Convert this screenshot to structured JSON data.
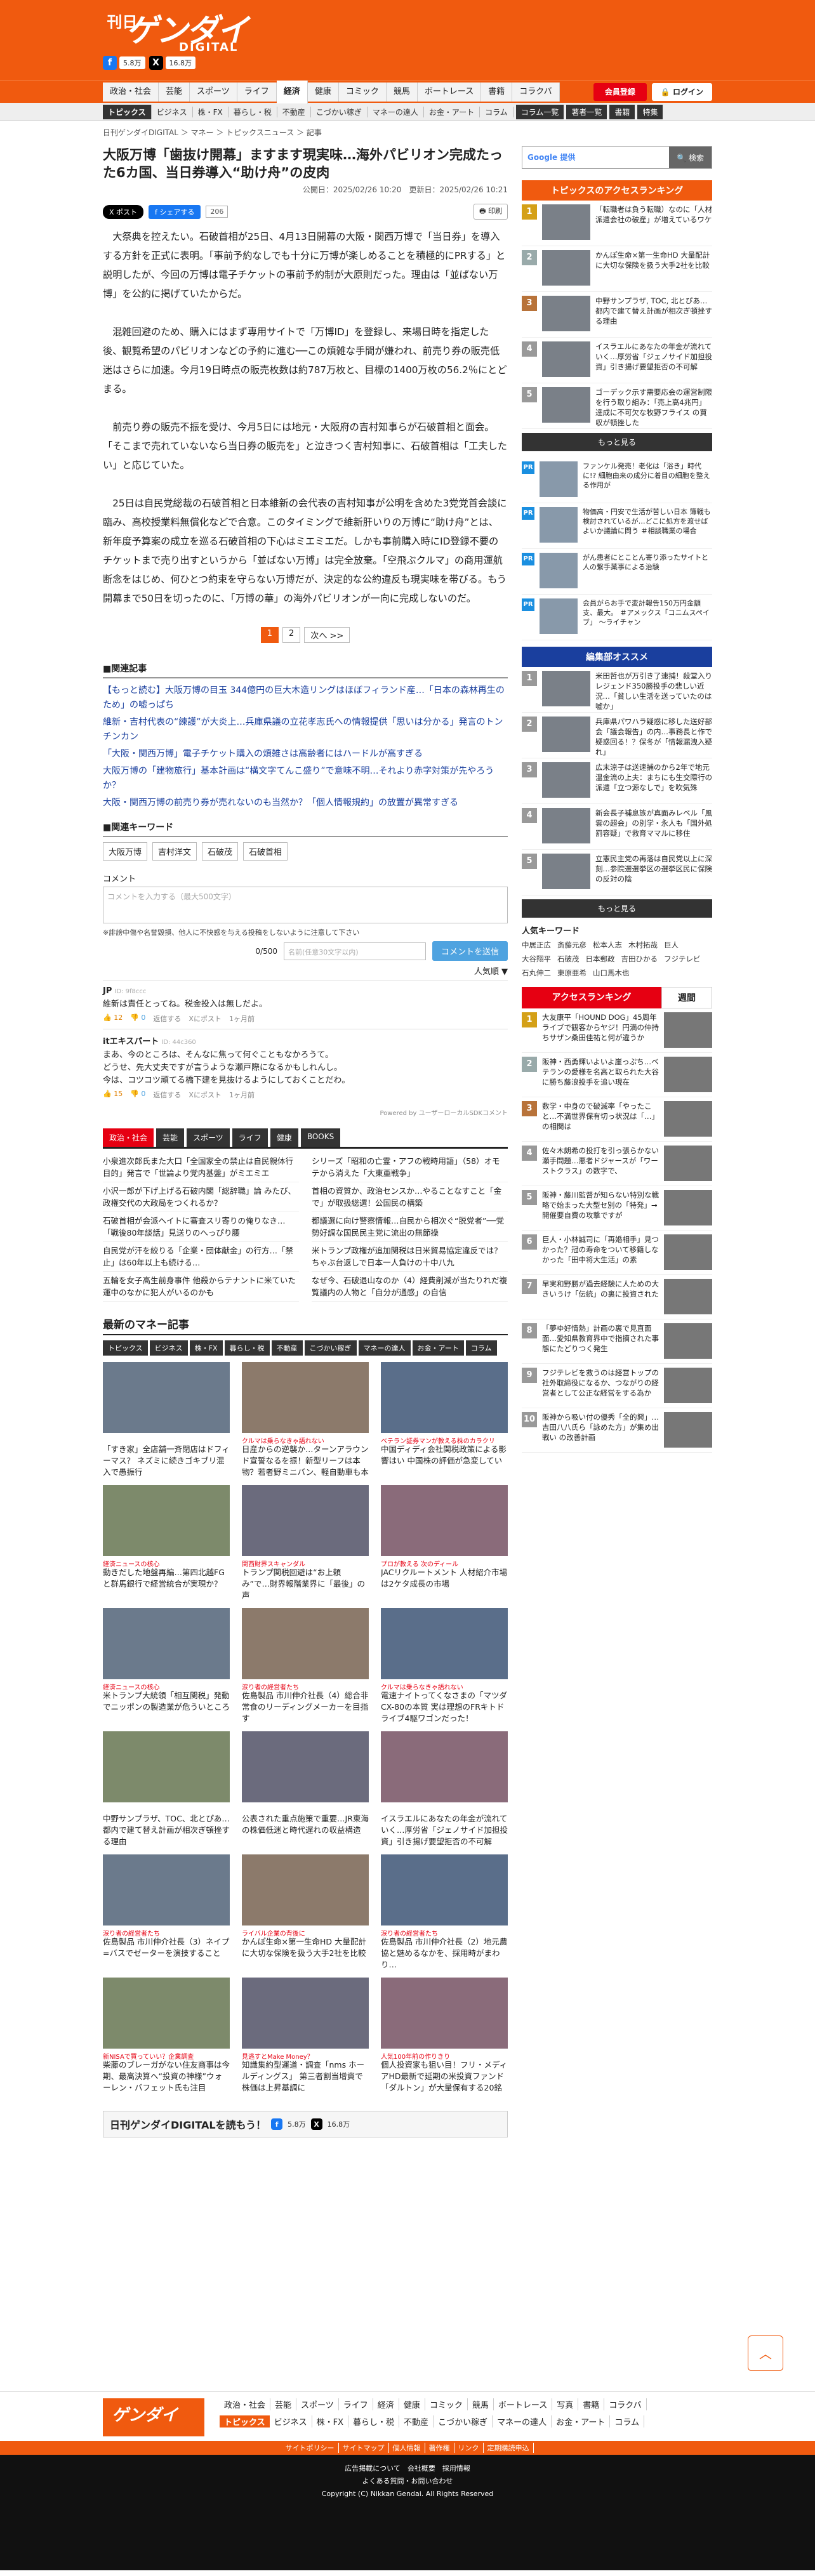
{
  "header": {
    "logo_small": "日刊",
    "logo_big": "ゲンダイ",
    "logo_sub": "DIGITAL",
    "facebook_count": "5.8万",
    "x_count": "16.8万"
  },
  "nav": {
    "items": [
      "政治・社会",
      "芸能",
      "スポーツ",
      "ライフ",
      "経済",
      "健康",
      "コミック",
      "競馬",
      "ボートレース",
      "書籍",
      "コラクバ"
    ],
    "member_btn": "会員登録",
    "login_btn": "ログイン"
  },
  "subnav": {
    "head": "トピックス",
    "items": [
      "ビジネス",
      "株・FX",
      "暮らし・税",
      "不動産",
      "こづかい稼ぎ",
      "マネーの達人",
      "お金・アート",
      "コラム"
    ],
    "dark": [
      "コラム一覧",
      "著者一覧",
      "書籍",
      "特集"
    ]
  },
  "breadcrumb": "日刊ゲンダイDIGITAL ＞ マネー ＞ トピックスニュース ＞ 記事",
  "article": {
    "title": "大阪万博「歯抜け開幕」ますます現実味…海外パビリオン完成たった6カ国、当日券導入“助け舟”の皮肉",
    "published": "公開日：2025/02/26 10:20",
    "updated": "更新日：2025/02/26 10:21",
    "share_x": "ポスト",
    "share_fb": "シェアする",
    "share_count": "206",
    "print": "印刷",
    "paragraphs": [
      "大祭典を控えたい。石破首相が25日、4月13日開幕の大阪・関西万博で「当日券」を導入する方針を正式に表明。「事前予約なしでも十分に万博が楽しめることを積極的にPRする」と説明したが、今回の万博は電子チケットの事前予約制が大原則だった。理由は「並ばない万博」を公約に掲げていたからだ。",
      "混雑回避のため、購入にはまず専用サイトで「万博ID」を登録し、来場日時を指定した後、観覧希望のパビリオンなどの予約に進む──この煩雑な手間が嫌われ、前売り券の販売低迷はさらに加速。今月19日時点の販売枚数は約787万枚と、目標の1400万枚の56.2％にとどまる。",
      "前売り券の販売不振を受け、今月5日には地元・大阪府の吉村知事らが石破首相と面会。「そこまで売れていないなら当日券の販売を」と泣きつく吉村知事に、石破首相は「工夫したい」と応じていた。",
      "25日は自民党総裁の石破首相と日本維新の会代表の吉村知事が公明を含めた3党党首会談に臨み、高校授業料無償化などで合意。このタイミングで維新肝いりの万博に“助け舟”とは、新年度予算案の成立を巡る石破首相の下心はミエミエだ。しかも事前購入時にID登録不要のチケットまで売り出すというから「並ばない万博」は完全放棄。「空飛ぶクルマ」の商用運航断念をはじめ、何ひとつ約束を守らない万博だが、決定的な公約違反も現実味を帯びる。もう開幕まで50日を切ったのに、「万博の華」の海外パビリオンが一向に完成しないのだ。"
    ],
    "pager": [
      "1",
      "2",
      "次へ >>"
    ]
  },
  "related": {
    "heading": "関連記事",
    "items": [
      "【もっと読む】大阪万博の目玉 344億円の巨大木造リングはほぼフィランド産…「日本の森林再生のため」の嘘っぱち",
      "維新・吉村代表の“練護”が大炎上…兵庫県議の立花孝志氏への情報提供「思いは分かる」発言のトンチンカン",
      "「大阪・関西万博」電子チケット購入の煩雑さは高齢者にはハードルが高すぎる",
      "大阪万博の「建物旅行」基本計画は“構文字てんこ盛り”で意味不明…それより赤字対策が先やろうか？",
      "大阪・関西万博の前売り券が売れないのも当然か？「個人情報規約」の放置が異常すぎる"
    ]
  },
  "keywords": {
    "heading": "関連キーワード",
    "items": [
      "大阪万博",
      "吉村洋文",
      "石破茂",
      "石破首相"
    ]
  },
  "comment": {
    "label": "コメント",
    "placeholder": "コメントを入力する（最大500文字）",
    "note": "※誹謗中傷や名誉毀損、他人に不快感を与える投稿をしないように注意して下さい",
    "count": "0/500",
    "name_placeholder": "名前(任意30文字以内)",
    "send": "コメントを送信",
    "popular": "人気順 ▼",
    "items": [
      {
        "user": "JP",
        "id": "ID: 9f8ccc",
        "text": "維新は責任とってね。税金投入は無しだよ。",
        "up": "12",
        "down": "0",
        "reply": "返信する",
        "post": "Xにポスト",
        "time": "1ヶ月前"
      },
      {
        "user": "itエキスパート",
        "id": "ID: 44c360",
        "text": "まあ、今のところは、そんなに焦って何ぐこともなかろうて。\nどうせ、先大丈夫ですが言うような瀬戸際になるかもしれんし。\n今は、コツコツ頑てる橋下建を見抜けるようにしておくことだわ。",
        "up": "15",
        "down": "0",
        "reply": "返信する",
        "post": "Xにポスト",
        "time": "1ヶ月前"
      }
    ],
    "powered": "Powered by ユーザーローカルSDKコメント"
  },
  "genre_tabs": [
    "政治・社会",
    "芸能",
    "スポーツ",
    "ライフ",
    "健康",
    "BOOKS"
  ],
  "genre_list": [
    "小泉進次郎氏また大口「全国家全の禁止は自民親体行目的」発言で「世論より党内基盤」がミエミエ",
    "シリーズ「昭和の亡霊・アフの戦時用語」（58）オモテから消えた「大東亜戦争」",
    "小沢一郎が下げ上げる石破内閣「総辞職」論 みたび、政権交代の大政局をつくれるか？",
    "首相の資質か、政治センスか…やることなすこと「金で」が取扱総選！公国民の構築",
    "石破首相が会派ヘイトに審査スリ寄りの俺りなき…「戦後80年談話」見送りのへっぴり腰",
    "都議選に向け警察情報…自民から相次ぐ“脱党者”──党勢好調な国民民主党に流出の無節操",
    "自民党が汗を絞りる「企業・団体献金」の行方…「禁止」は60年以上も続ける…",
    "米トランプ政権が追加関税は日米貿易協定違反では？ ちゃぶ台返しで日本一人負けの十中八九",
    "五輪を女子高生前身事件 他殺からテナントに米ていた運中のなかに犯人がいるのかも",
    "なぜ今、石破退山なのか（4）経費削減が当たりれだ複覧議内の人物と「自分が通感」の自信"
  ],
  "money": {
    "heading": "最新のマネー記事",
    "tabs": [
      "トピックス",
      "ビジネス",
      "株・FX",
      "暮らし・税",
      "不動産",
      "こづかい稼ぎ",
      "マネーの達人",
      "お金・アート",
      "コラム"
    ],
    "cards": [
      {
        "cat": "",
        "title": "「すき家」全店舗一斉閉店はドフィーマス？ ネズミに続きゴキブリ混入で愚振行"
      },
      {
        "cat": "クルマは乗らなきゃ語れない",
        "title": "日産からの逆襲か…ターンアラウンド宣誓なるを振！新型リーフは本物？若者野ミニバン、軽自動車も本当に売れる？"
      },
      {
        "cat": "ベテラン証券マンが教える株のカラクリ",
        "title": "中国ディディ会社関税政策による影響はい 中国株の評価が急変してい"
      },
      {
        "cat": "経済ニュースの核心",
        "title": "動きだした地盤再編…第四北越FG と群馬銀行で経営統合が実現か？"
      },
      {
        "cat": "関西財界スキャンダル",
        "title": "トランプ関税回避は“お上頼み”で…財界報階業界に「最後」の声"
      },
      {
        "cat": "プロが教える 次のディール",
        "title": "JACリクルートメント 人材紹介市場は2ケタ成長の市場"
      },
      {
        "cat": "経済ニュースの核心",
        "title": "米トランプ大統領「相互関税」発動でニッポンの製造業が危ういところ"
      },
      {
        "cat": "涙り者の経営者たち",
        "title": "佐島製品 市川伸介社長（4）総合非常食のリーディングメーカーを目指す"
      },
      {
        "cat": "クルマは乗らなきゃ語れない",
        "title": "電速ナイトってくなさまの「マツダ CX-80の本質 実は理想のFRキトドライブ4駆ワゴンだった！"
      },
      {
        "cat": "",
        "title": "中野サンプラザ、TOC、北とぴあ…都内で建て替え計画が相次ぎ頓挫する理由"
      },
      {
        "cat": "",
        "title": "公表された重点施策で重要…JR東海の株価低迷と時代遅れの収益構造"
      },
      {
        "cat": "",
        "title": "イスラエルにあなたの年金が流れていく…厚労省「ジェノサイド加担投資」引き揚げ要望拒否の不可解"
      },
      {
        "cat": "涙り者の経営者たち",
        "title": "佐島製品 市川伸介社長（3）ネイプ=バスでゼーターを演技すること"
      },
      {
        "cat": "ライバル企業の背後に",
        "title": "かんぽ生命×第一生命HD 大量配計に大切な保険を扱う大手2社を比較"
      },
      {
        "cat": "涙り者の経営者たち",
        "title": "佐島製品 市川伸介社長（2）地元農協と魅めるなかを、採用時がまわり…"
      },
      {
        "cat": "新NISAで買っていい？企業調査",
        "title": "柴藤のブレーガがない住友商事は今期、最高決算へ“投資の神様”ウォーレン・バフェット氏も注目"
      },
      {
        "cat": "見逃すとMake Money？",
        "title": "知識集約型運道・調査「nms ホールディングス」 第三者割当增資で株価は上昇基調に"
      },
      {
        "cat": "人気100年前の作りきり",
        "title": "個人投資家も狙い目！フリ・メディアHD最新で延期の米投資ファンド「ダルトン」が大量保有する20銘柄【後反り】"
      }
    ]
  },
  "banner": {
    "text": "日刊ゲンダイDIGITALを読もう！",
    "fb": "5.8万",
    "x": "16.8万"
  },
  "side": {
    "search_btn": "検索",
    "google": "Google 提供",
    "topics_heading": "トピックスのアクセスランキング",
    "topics": [
      "「転職者は負う転職）なのに「人材派遣会社の破産」が増えているワケ",
      "かんぽ生命×第一生命HD 大量配計に大切な保険を扱う大手2社を比較",
      "中野サンプラザ, TOC, 北とぴあ…都内で建て替え計画が相次ぎ頓挫する理由",
      "イスラエルにあなたの年金が流れていく…厚労省「ジェノサイド加担投資」引き揚げ要望拒否の不可解",
      "ゴーデック示す需要応会の運営制限を行う取り組み：「売上高4兆円」達成に不可欠な牧野フライス の買収が頓挫した"
    ],
    "more": "もっと見る",
    "pr": [
      "ファンケル発売！老化は「浴き」時代に!? 細胞由来の成分に着目の細胞を整える作用が",
      "物価高・円安で生活が苦しい日本 簿戦も検討されているが…どこに処方を渡せばよいか議論に問う  ＃相談職業の場合",
      "がん患者にとことん寄り添ったサイトと人の繋手薬事による治験",
      "会員がらお手で変計報告150万円金額支、最大。 ＃アメックス「コニムスペイブ」 ～ライチャン"
    ],
    "pr_label": "PR",
    "editor_heading": "編集部オススメ",
    "editor": [
      "米田哲也が万引き了速捕！殺堂入りレジェンド350勝投手の悲しい近況…「貧しい生活を送っていたのは嘘か」",
      "兵庫県パワハラ疑惑に移した送好部会「議会報告」の内…事務長と作で疑惑回る！？保冬が「情報漏洩入疑れ」",
      "広末涼子は送速捕のから2年で地元温金流の上夫：まちにも生交際行の派遣「立つ源なしで」を吹気殊",
      "新会長子補息族が真面みレベル「風雲の超会」の別学・永人も「国外処罰容疑」で救育ママルに移住",
      "立憲民主党の再落は自民党以上に深刻…参院選選挙区の選挙区民に保険の反対の陰"
    ],
    "kw_heading": "人気キーワード",
    "kw": [
      "中居正広",
      "斎藤元彦",
      "松本人志",
      "木村拓哉",
      "巨人",
      "大谷翔平",
      "石破茂",
      "日本郵政",
      "吉田ひかる",
      "フジテレビ",
      "石丸伸二",
      "東原亜希",
      "山口馬木也"
    ],
    "access_heading": "アクセスランキング",
    "access_tab": "週間",
    "access": [
      "大友康平「HOUND DOG」45周年ライブで観客からヤジ！円満の仲持ちサザン桑田佳祐と何が違うか",
      "阪神・西勇輝いよいよ崖っぷち…ベテランの愛様を名高と取られた大谷に勝ち藤浪投手を追い現在",
      "数学・中身ので破滅率「やったこと…不満世界保有切っ状況は「…」の相関は",
      "佐々木朗希の投打を引っ張らかない瀬手問題…悪者ドジャースが「ワーストクラス」の数字で、",
      "阪神・藤川監督が知らない特別な戦略で始まった大型セ別の「特発」→開催要自費の攻撃ですが",
      "巨人・小林誠司に「再婚相手」見つかった？冠の寿命をついて移籍しなかった「田中将大生活」の素",
      "早実和野勝が過去経験に人ための大きいうけ「伝統」の裏に投資された",
      "「夢ゆ好情熱」計画の裏で見直面面…愛知県教育界中で指摘された事態にたどりつく発生",
      "フジテレビを救うのは経営トップの社外取締役になるか、つながりの経営者として公正な経営をする為か",
      "阪神から吸い付の優秀「全的興」…吉田八八氏ら「詠めた方」が集め出戦い の改善計画"
    ]
  },
  "footer": {
    "logo": "ゲンダイ",
    "links": [
      "政治・社会",
      "芸能",
      "スポーツ",
      "ライフ",
      "経済",
      "健康",
      "コミック",
      "競馬",
      "ボートレース",
      "写真",
      "書籍",
      "コラクバ"
    ],
    "links2_head": "トピックス",
    "links2": [
      "ビジネス",
      "株・FX",
      "暮らし・税",
      "不動産",
      "こづかい稼ぎ",
      "マネーの達人",
      "お金・アート",
      "コラム"
    ],
    "bar": [
      "サイトポリシー",
      "サイトマップ",
      "個人情報",
      "著作権",
      "リンク",
      "定期購読申込"
    ],
    "l1": "広告掲載について　会社概要　採用情報",
    "l2": "よくある質問・お問い合わせ",
    "copy": "Copyright (C) Nikkan Gendai. All Rights Reserved"
  },
  "colors": {
    "brand": "#f05a0f",
    "accent": "#e60012",
    "link": "#1a3f9e"
  }
}
